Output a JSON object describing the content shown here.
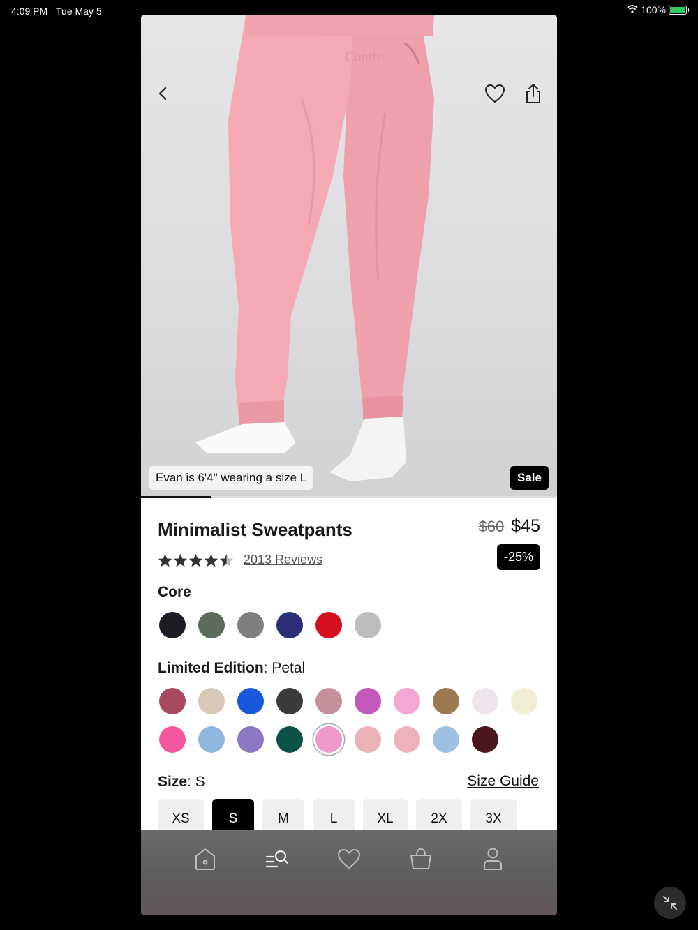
{
  "status_bar": {
    "time": "4:09 PM",
    "date": "Tue May 5",
    "battery": "100%",
    "battery_level": 1.0
  },
  "hero": {
    "brand_text": "Comfrt",
    "model_caption": "Evan is 6'4\" wearing a size L",
    "sale_badge": "Sale",
    "gallery_progress": 0.17,
    "icons": {
      "back": "chevron-left-icon",
      "favorite": "heart-icon",
      "share": "share-icon"
    }
  },
  "product": {
    "title": "Minimalist Sweatpants",
    "old_price": "$60",
    "new_price": "$45",
    "discount": "-25%",
    "rating_stars": 4.5,
    "reviews_text": "2013 Reviews"
  },
  "core": {
    "label": "Core",
    "swatches": [
      "#1c1d24",
      "#5c6b5c",
      "#7f7f80",
      "#2a2f78",
      "#d4101f",
      "#bebdbb"
    ]
  },
  "limited": {
    "label": "Limited Edition",
    "selected": "Petal",
    "selected_index": 14,
    "swatches": [
      "#a84a5e",
      "#d8c8b8",
      "#1859dc",
      "#3a3b3c",
      "#c6909b",
      "#c358bc",
      "#f6a6d2",
      "#9b7a52",
      "#f1e3ec",
      "#f3ecd4",
      "#f2579c",
      "#8fb7de",
      "#8e78c4",
      "#0c5248",
      "#f09acb",
      "#ebb2b8",
      "#eeb2bd",
      "#9ec1e3",
      "#4c1620"
    ]
  },
  "size": {
    "label": "Size",
    "selected": "S",
    "guide_label": "Size Guide",
    "options": [
      "XS",
      "S",
      "M",
      "L",
      "XL",
      "2X",
      "3X"
    ]
  },
  "tab_bar": {
    "icons": [
      "home-icon",
      "search-list-icon",
      "heart-icon",
      "bag-icon",
      "profile-icon"
    ]
  },
  "colors": {
    "accent": "#000000",
    "pants": "#f4a9b4"
  }
}
